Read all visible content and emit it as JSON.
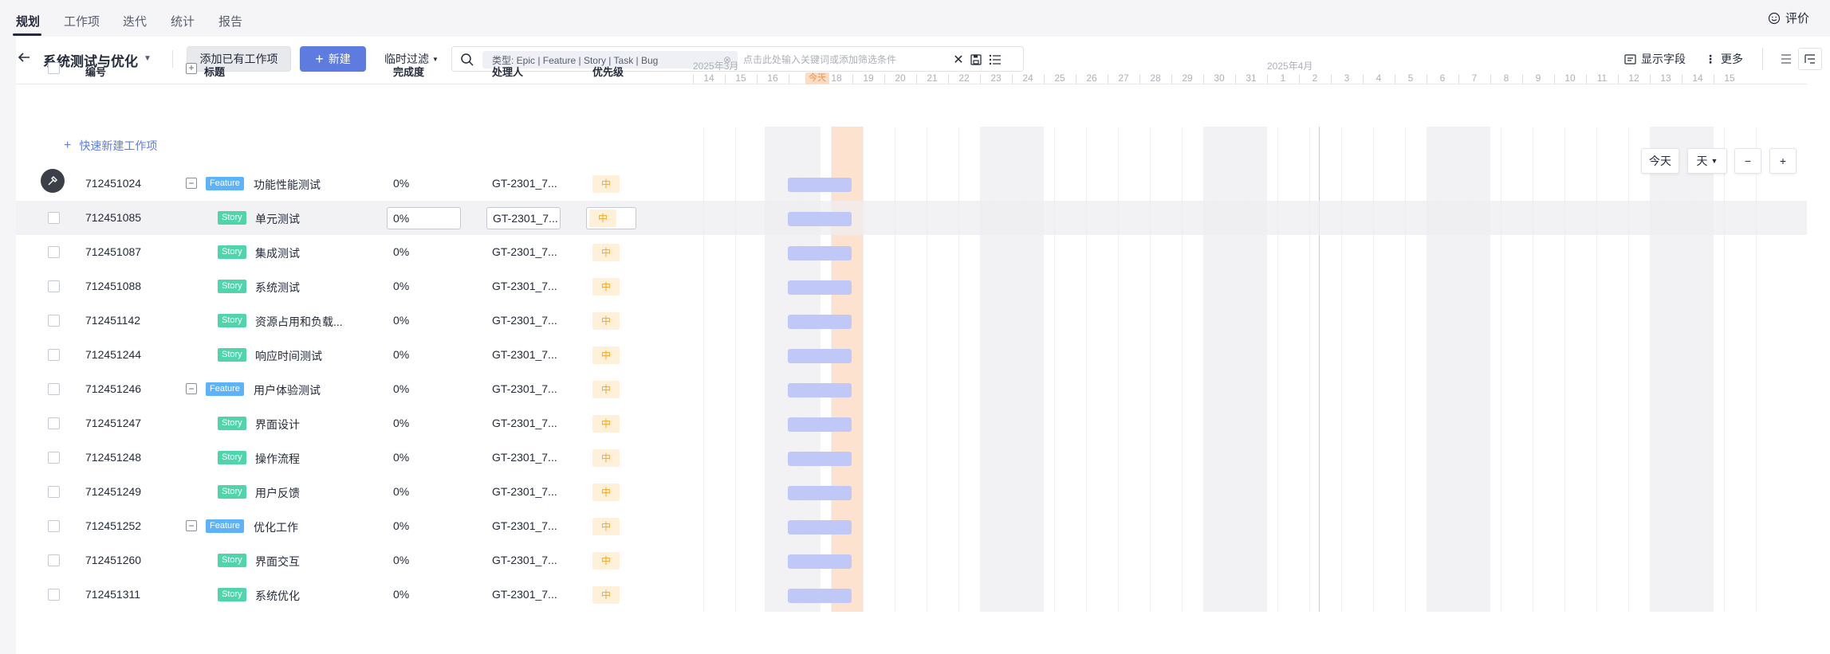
{
  "top_tabs": [
    "规划",
    "工作项",
    "迭代",
    "统计",
    "报告"
  ],
  "evaluate_label": "评价",
  "toolbar": {
    "project_title": "系统测试与优化",
    "add_existing_label": "添加已有工作项",
    "new_label": "新建",
    "temp_filter_label": "临时过滤",
    "filter_chip": "类型:  Epic  |  Feature  |  Story  |  Task  |  Bug",
    "search_placeholder": "点击此处输入关键词或添加筛选条件",
    "show_fields_label": "显示字段",
    "more_label": "更多"
  },
  "table_headers": {
    "id": "编号",
    "title": "标题",
    "progress": "完成度",
    "assignee": "处理人",
    "priority": "优先级"
  },
  "quick_add_label": "快速新建工作项",
  "gantt": {
    "months": [
      "2025年3月",
      "2025年4月"
    ],
    "days": [
      "14",
      "15",
      "16",
      "今天",
      "18",
      "19",
      "20",
      "21",
      "22",
      "23",
      "24",
      "25",
      "26",
      "27",
      "28",
      "29",
      "30",
      "31",
      "1",
      "2",
      "3",
      "4",
      "5",
      "6",
      "7",
      "8",
      "9",
      "10",
      "11",
      "12",
      "13",
      "14",
      "15"
    ],
    "today_label": "今天",
    "scale_label": "天",
    "today_button": "今天",
    "zoom_out": "−",
    "zoom_in": "+"
  },
  "rows": [
    {
      "id": "712451024",
      "type": "Feature",
      "title": "功能性能测试",
      "progress": "0%",
      "assignee": "GT-2301_7...",
      "priority": "中"
    },
    {
      "id": "712451085",
      "type": "Story",
      "title": "单元测试",
      "progress": "0%",
      "assignee": "GT-2301_7...",
      "priority": "中"
    },
    {
      "id": "712451087",
      "type": "Story",
      "title": "集成测试",
      "progress": "0%",
      "assignee": "GT-2301_7...",
      "priority": "中"
    },
    {
      "id": "712451088",
      "type": "Story",
      "title": "系统测试",
      "progress": "0%",
      "assignee": "GT-2301_7...",
      "priority": "中"
    },
    {
      "id": "712451142",
      "type": "Story",
      "title": "资源占用和负载...",
      "progress": "0%",
      "assignee": "GT-2301_7...",
      "priority": "中"
    },
    {
      "id": "712451244",
      "type": "Story",
      "title": "响应时间测试",
      "progress": "0%",
      "assignee": "GT-2301_7...",
      "priority": "中"
    },
    {
      "id": "712451246",
      "type": "Feature",
      "title": "用户体验测试",
      "progress": "0%",
      "assignee": "GT-2301_7...",
      "priority": "中"
    },
    {
      "id": "712451247",
      "type": "Story",
      "title": "界面设计",
      "progress": "0%",
      "assignee": "GT-2301_7...",
      "priority": "中"
    },
    {
      "id": "712451248",
      "type": "Story",
      "title": "操作流程",
      "progress": "0%",
      "assignee": "GT-2301_7...",
      "priority": "中"
    },
    {
      "id": "712451249",
      "type": "Story",
      "title": "用户反馈",
      "progress": "0%",
      "assignee": "GT-2301_7...",
      "priority": "中"
    },
    {
      "id": "712451252",
      "type": "Feature",
      "title": "优化工作",
      "progress": "0%",
      "assignee": "GT-2301_7...",
      "priority": "中"
    },
    {
      "id": "712451260",
      "type": "Story",
      "title": "界面交互",
      "progress": "0%",
      "assignee": "GT-2301_7...",
      "priority": "中"
    },
    {
      "id": "712451311",
      "type": "Story",
      "title": "系统优化",
      "progress": "0%",
      "assignee": "GT-2301_7...",
      "priority": "中"
    }
  ],
  "colors": {
    "primary": "#5e7ce0",
    "feature_tag": "#5eb2f7",
    "story_tag": "#50d4ab",
    "priority_bg": "#fff1d9",
    "priority_text": "#f5a623",
    "bar": "#bfc8f6",
    "today_column": "#fde3cf"
  }
}
